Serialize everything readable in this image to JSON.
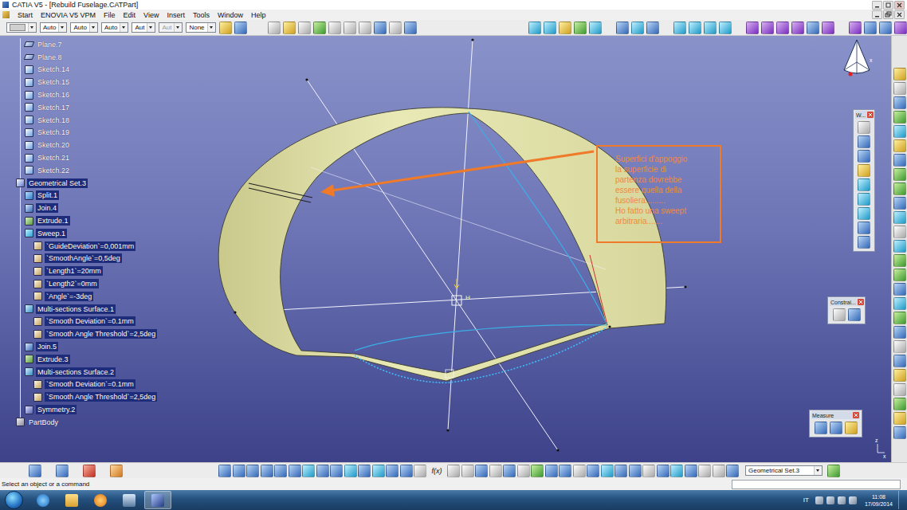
{
  "window": {
    "title": "CATIA V5 - [Rebuild Fuselage.CATPart]"
  },
  "menu": [
    "Start",
    "ENOVIA V5 VPM",
    "File",
    "Edit",
    "View",
    "Insert",
    "Tools",
    "Window",
    "Help"
  ],
  "toolbar": {
    "dropdowns": [
      {
        "kind": "swatch",
        "value": "",
        "disabled": false
      },
      {
        "kind": "select",
        "value": "Auto",
        "disabled": false
      },
      {
        "kind": "select",
        "value": "Auto",
        "disabled": false
      },
      {
        "kind": "select",
        "value": "Auto",
        "disabled": false
      },
      {
        "kind": "select",
        "value": "Aut",
        "disabled": false
      },
      {
        "kind": "select",
        "value": "Aut",
        "disabled": true
      },
      {
        "kind": "select",
        "value": "None",
        "disabled": false
      }
    ]
  },
  "tree": [
    {
      "label": "Plane.7",
      "level": 1,
      "kind": "plane",
      "selected": false
    },
    {
      "label": "Plane.8",
      "level": 1,
      "kind": "plane",
      "selected": false
    },
    {
      "label": "Sketch.14",
      "level": 1,
      "kind": "sketch",
      "selected": false
    },
    {
      "label": "Sketch.15",
      "level": 1,
      "kind": "sketch",
      "selected": false
    },
    {
      "label": "Sketch.16",
      "level": 1,
      "kind": "sketch",
      "selected": false
    },
    {
      "label": "Sketch.17",
      "level": 1,
      "kind": "sketch",
      "selected": false
    },
    {
      "label": "Sketch.18",
      "level": 1,
      "kind": "sketch",
      "selected": false
    },
    {
      "label": "Sketch.19",
      "level": 1,
      "kind": "sketch",
      "selected": false
    },
    {
      "label": "Sketch.20",
      "level": 1,
      "kind": "sketch",
      "selected": false
    },
    {
      "label": "Sketch.21",
      "level": 1,
      "kind": "sketch",
      "selected": false
    },
    {
      "label": "Sketch.22",
      "level": 1,
      "kind": "sketch",
      "selected": false
    },
    {
      "label": "Geometrical Set.3",
      "level": 0,
      "kind": "set",
      "selected": true
    },
    {
      "label": "Split.1",
      "level": 1,
      "kind": "split",
      "selected": true
    },
    {
      "label": "Join.4",
      "level": 1,
      "kind": "join",
      "selected": true
    },
    {
      "label": "Extrude.1",
      "level": 1,
      "kind": "extrude",
      "selected": true
    },
    {
      "label": "Sweep.1",
      "level": 1,
      "kind": "sweep",
      "selected": true
    },
    {
      "label": "`GuideDeviation`=0,001mm",
      "level": 2,
      "kind": "parameter",
      "selected": true
    },
    {
      "label": "`SmoothAngle`=0,5deg",
      "level": 2,
      "kind": "parameter",
      "selected": true
    },
    {
      "label": "`Length1`=20mm",
      "level": 2,
      "kind": "parameter",
      "selected": true
    },
    {
      "label": "`Length2`=0mm",
      "level": 2,
      "kind": "parameter",
      "selected": true
    },
    {
      "label": "`Angle`=-3deg",
      "level": 2,
      "kind": "parameter",
      "selected": true
    },
    {
      "label": "Multi-sections Surface.1",
      "level": 1,
      "kind": "multisection",
      "selected": true
    },
    {
      "label": "`Smooth Deviation`=0.1mm",
      "level": 2,
      "kind": "parameter",
      "selected": true
    },
    {
      "label": "`Smooth Angle Threshold`=2,5deg",
      "level": 2,
      "kind": "parameter",
      "selected": true
    },
    {
      "label": "Join.5",
      "level": 1,
      "kind": "join",
      "selected": true
    },
    {
      "label": "Extrude.3",
      "level": 1,
      "kind": "extrude",
      "selected": true
    },
    {
      "label": "Multi-sections Surface.2",
      "level": 1,
      "kind": "multisection",
      "selected": true
    },
    {
      "label": "`Smooth Deviation`=0.1mm",
      "level": 2,
      "kind": "parameter",
      "selected": true
    },
    {
      "label": "`Smooth Angle Threshold`=2,5deg",
      "level": 2,
      "kind": "parameter",
      "selected": true
    },
    {
      "label": "Symmetry.2",
      "level": 1,
      "kind": "symmetry",
      "selected": true
    },
    {
      "label": "PartBody",
      "level": 0,
      "kind": "body",
      "selected": false
    }
  ],
  "viewport": {
    "center_label": "H",
    "compass_label": "x",
    "triad": {
      "z": "z",
      "x": "x"
    }
  },
  "annotation": {
    "lines": [
      "Superfici d'appoggio",
      "la superficie di",
      "partenza dovrebbe",
      "essere quella della",
      "fusoliera.........",
      "Ho fatto una sweept",
      "arbitraria......."
    ]
  },
  "floating_toolbars": [
    {
      "title": "W..."
    },
    {
      "title": "Constrai..."
    },
    {
      "title": "Measure"
    }
  ],
  "bottom_toolbar": {
    "formula": "f(x)",
    "dropdown": "Geometrical Set.3"
  },
  "status_bar": {
    "message": "Select an object or a command"
  },
  "taskbar": {
    "language": "IT",
    "time": "11:08",
    "date": "17/09/2014"
  }
}
